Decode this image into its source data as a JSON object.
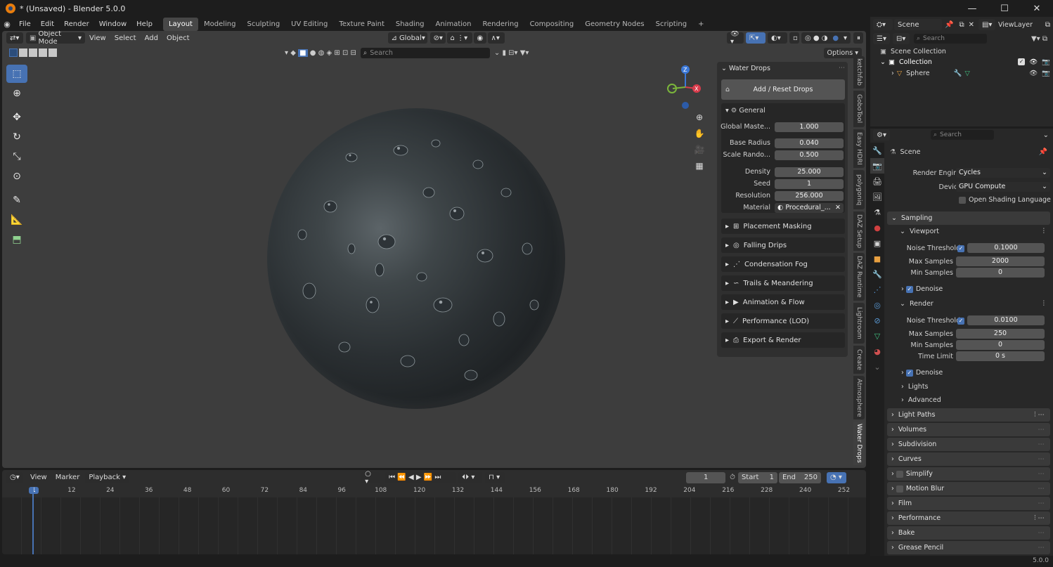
{
  "window": {
    "title": "* (Unsaved) - Blender 5.0.0",
    "min": "—",
    "max": "☐",
    "close": "✕"
  },
  "menu": {
    "items": [
      "File",
      "Edit",
      "Render",
      "Window",
      "Help"
    ]
  },
  "workspaces": [
    "Layout",
    "Modeling",
    "Sculpting",
    "UV Editing",
    "Texture Paint",
    "Shading",
    "Animation",
    "Rendering",
    "Compositing",
    "Geometry Nodes",
    "Scripting",
    "+"
  ],
  "scene": {
    "label": "Scene",
    "viewlayer": "ViewLayer"
  },
  "viewport": {
    "mode": "Object Mode",
    "menus": [
      "View",
      "Select",
      "Add",
      "Object"
    ],
    "transform": "Global",
    "search_placeholder": "Search",
    "options": "Options",
    "gizmo": {
      "z": "Z",
      "x": "X"
    }
  },
  "npanel": {
    "title": "Water Drops",
    "add_reset": "Add / Reset Drops",
    "general": "General",
    "fields": [
      {
        "label": "Global Maste...",
        "value": "1.000"
      },
      {
        "label": "Base Radius",
        "value": "0.040"
      },
      {
        "label": "Scale Rando...",
        "value": "0.500"
      },
      {
        "label": "Density",
        "value": "25.000"
      },
      {
        "label": "Seed",
        "value": "1"
      },
      {
        "label": "Resolution",
        "value": "256.000"
      }
    ],
    "material_label": "Material",
    "material_value": "Procedural_...",
    "sections": [
      "Placement Masking",
      "Falling Drips",
      "Condensation Fog",
      "Trails & Meandering",
      "Animation & Flow",
      "Performance (LOD)",
      "Export & Render"
    ]
  },
  "vtabs": [
    "ketchfab",
    "GoboTool",
    "Easy HDRI",
    "polygoniq",
    "DAZ Setup",
    "DAZ Runtime",
    "Lightroom",
    "Create",
    "Atmosphere",
    "Water Drops"
  ],
  "timeline": {
    "menus": [
      "View",
      "Marker",
      "Playback"
    ],
    "current_frame": "1",
    "start_label": "Start",
    "start": "1",
    "end_label": "End",
    "end": "250",
    "ticks": [
      "1",
      "12",
      "24",
      "36",
      "48",
      "60",
      "72",
      "84",
      "96",
      "108",
      "120",
      "132",
      "144",
      "156",
      "168",
      "180",
      "192",
      "204",
      "216",
      "228",
      "240",
      "252"
    ]
  },
  "outliner": {
    "search_placeholder": "Search",
    "scene_collection": "Scene Collection",
    "collection": "Collection",
    "object": "Sphere"
  },
  "properties": {
    "search_placeholder": "Search",
    "context": "Scene",
    "render_engine_label": "Render Engine",
    "render_engine": "Cycles",
    "device_label": "Device",
    "device": "GPU Compute",
    "osl": "Open Shading Language",
    "sampling": "Sampling",
    "viewport": "Viewport",
    "vp_noise_label": "Noise Threshold",
    "vp_noise": "0.1000",
    "vp_max_label": "Max Samples",
    "vp_max": "2000",
    "vp_min_label": "Min Samples",
    "vp_min": "0",
    "denoise": "Denoise",
    "render": "Render",
    "r_noise_label": "Noise Threshold",
    "r_noise": "0.0100",
    "r_max_label": "Max Samples",
    "r_max": "250",
    "r_min_label": "Min Samples",
    "r_min": "0",
    "time_limit_label": "Time Limit",
    "time_limit": "0 s",
    "denoise2": "Denoise",
    "lights": "Lights",
    "advanced": "Advanced",
    "sections": [
      "Light Paths",
      "Volumes",
      "Subdivision",
      "Curves",
      "Simplify",
      "Motion Blur",
      "Film",
      "Performance",
      "Bake",
      "Grease Pencil"
    ]
  },
  "status": {
    "version": "5.0.0"
  },
  "colors": {
    "accent": "#4772b3",
    "orange": "#e87d0d",
    "viewport_bg": "#3d3d3d"
  }
}
